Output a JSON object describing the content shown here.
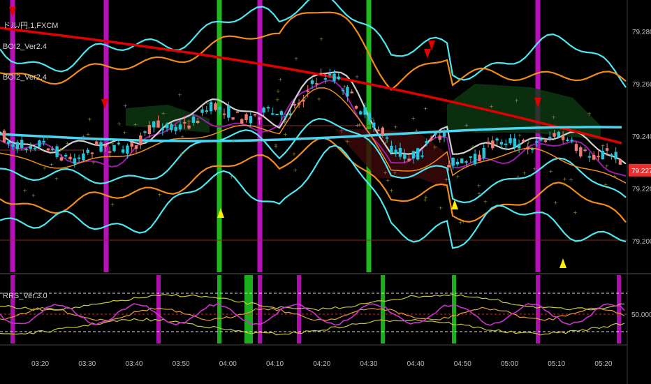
{
  "chart_data": {
    "type": "line",
    "title": "ドル/円,1,FXCM",
    "indicators": [
      "BOI2_Ver2.4",
      "BOI2_Ver2.4"
    ],
    "sub_indicator": "RRS_Ver.3.0",
    "y_ticks": [
      "79.280",
      "79.260",
      "79.240",
      "79.220",
      "79.200"
    ],
    "ylim": [
      79.188,
      79.292
    ],
    "price_label": "79.227",
    "x_ticks": [
      "03:20",
      "03:30",
      "03:40",
      "03:50",
      "04:00",
      "04:10",
      "04:20",
      "04:30",
      "04:40",
      "04:50",
      "05:00",
      "05:10",
      "05:20"
    ],
    "sub_ticks": [
      "50.0000"
    ],
    "colors": {
      "up": "#26c6da",
      "down": "#ef7b73",
      "magenta": "#cc11cc",
      "green": "#22cc22",
      "red": "#e00000",
      "cyan": "#4fe6f0",
      "orange": "#f08c1e",
      "price_tag": "#e83030"
    }
  }
}
